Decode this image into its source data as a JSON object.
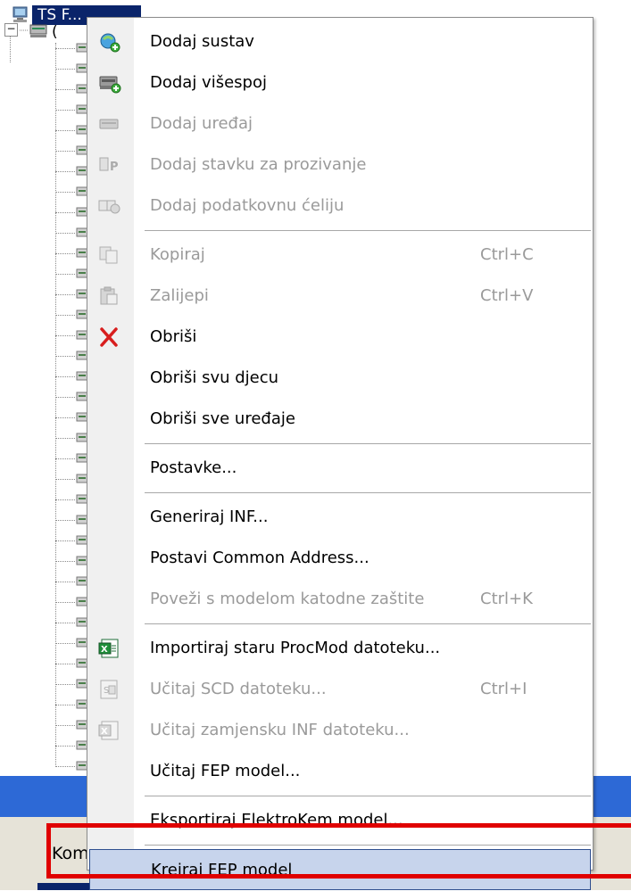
{
  "tree": {
    "root_label": "TS F...",
    "expander_symbol": "−",
    "child_label": "("
  },
  "context_menu": {
    "groups": [
      [
        {
          "label": "Dodaj sustav",
          "shortcut": "",
          "enabled": true,
          "icon": "add-system-icon"
        },
        {
          "label": "Dodaj višespoj",
          "shortcut": "",
          "enabled": true,
          "icon": "add-multilink-icon"
        },
        {
          "label": "Dodaj uređaj",
          "shortcut": "",
          "enabled": false,
          "icon": "add-device-icon"
        },
        {
          "label": "Dodaj stavku za prozivanje",
          "shortcut": "",
          "enabled": false,
          "icon": "add-poll-item-icon"
        },
        {
          "label": "Dodaj podatkovnu ćeliju",
          "shortcut": "",
          "enabled": false,
          "icon": "add-data-cell-icon"
        }
      ],
      [
        {
          "label": "Kopiraj",
          "shortcut": "Ctrl+C",
          "enabled": false,
          "icon": "copy-icon"
        },
        {
          "label": "Zalijepi",
          "shortcut": "Ctrl+V",
          "enabled": false,
          "icon": "paste-icon"
        },
        {
          "label": "Obriši",
          "shortcut": "",
          "enabled": true,
          "icon": "delete-icon"
        },
        {
          "label": "Obriši svu djecu",
          "shortcut": "",
          "enabled": true,
          "icon": ""
        },
        {
          "label": "Obriši sve uređaje",
          "shortcut": "",
          "enabled": true,
          "icon": ""
        }
      ],
      [
        {
          "label": "Postavke...",
          "shortcut": "",
          "enabled": true,
          "icon": ""
        }
      ],
      [
        {
          "label": "Generiraj INF...",
          "shortcut": "",
          "enabled": true,
          "icon": ""
        },
        {
          "label": "Postavi Common Address...",
          "shortcut": "",
          "enabled": true,
          "icon": ""
        },
        {
          "label": "Poveži s modelom katodne zaštite",
          "shortcut": "Ctrl+K",
          "enabled": false,
          "icon": ""
        }
      ],
      [
        {
          "label": "Importiraj staru ProcMod datoteku...",
          "shortcut": "",
          "enabled": true,
          "icon": "import-excel-icon"
        },
        {
          "label": "Učitaj SCD datoteku...",
          "shortcut": "Ctrl+I",
          "enabled": false,
          "icon": "load-scd-icon"
        },
        {
          "label": "Učitaj zamjensku INF datoteku...",
          "shortcut": "",
          "enabled": false,
          "icon": "load-inf-icon"
        },
        {
          "label": "Učitaj FEP model...",
          "shortcut": "",
          "enabled": true,
          "icon": ""
        }
      ],
      [
        {
          "label": "Eksportiraj ElektroKem model...",
          "shortcut": "",
          "enabled": true,
          "icon": ""
        }
      ],
      [
        {
          "label": "Kreiraj FEP model",
          "shortcut": "",
          "enabled": true,
          "icon": "",
          "selected": true
        }
      ]
    ]
  },
  "toolbar": {
    "partial_label": "Kom"
  },
  "colors": {
    "selection_bg": "#0a246a",
    "highlight_border": "#e00000",
    "disabled_text": "#9a9a9a",
    "taskbar_blue": "#2d69d6"
  }
}
